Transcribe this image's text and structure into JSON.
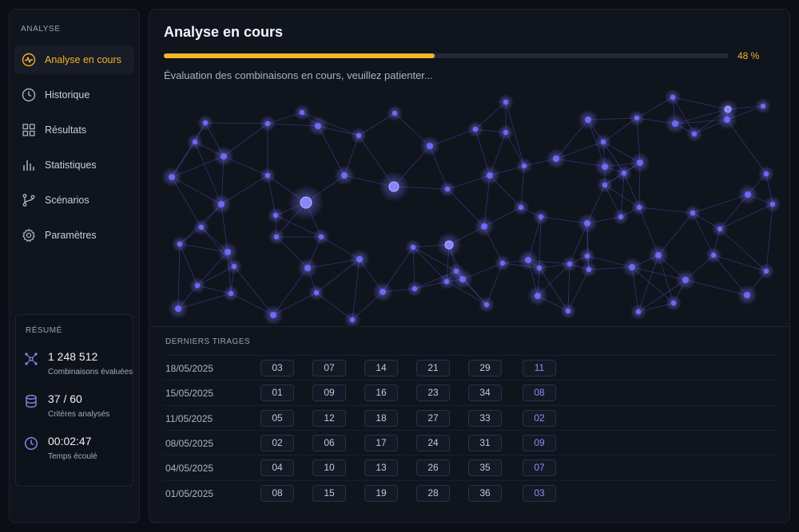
{
  "sidebar": {
    "heading": "ANALYSE",
    "items": [
      {
        "label": "Analyse en cours",
        "icon": "activity-icon",
        "active": true
      },
      {
        "label": "Historique",
        "icon": "clock-icon",
        "active": false
      },
      {
        "label": "Résultats",
        "icon": "grid-icon",
        "active": false
      },
      {
        "label": "Statistiques",
        "icon": "bar-chart-icon",
        "active": false
      },
      {
        "label": "Scénarios",
        "icon": "branch-icon",
        "active": false
      },
      {
        "label": "Paramètres",
        "icon": "gear-icon",
        "active": false
      }
    ],
    "summary": {
      "heading": "RÉSUMÉ",
      "stats": [
        {
          "value": "1 248 512",
          "label": "Combinaisons évaluées",
          "icon": "network-icon"
        },
        {
          "value": "37 / 60",
          "label": "Critères analysés",
          "icon": "database-icon"
        },
        {
          "value": "00:02:47",
          "label": "Temps écoulé",
          "icon": "clock-icon"
        }
      ]
    }
  },
  "main": {
    "title": "Analyse en cours",
    "progress": {
      "fraction": 0.48,
      "label": "48 %"
    },
    "status": "Évaluation des combinaisons en cours, veuillez patienter...",
    "draws": {
      "heading": "DERNIERS TIRAGES",
      "rows": [
        {
          "date": "18/05/2025",
          "numbers": [
            "03",
            "07",
            "14",
            "21",
            "29"
          ],
          "bonus": "11"
        },
        {
          "date": "15/05/2025",
          "numbers": [
            "01",
            "09",
            "16",
            "23",
            "34"
          ],
          "bonus": "08"
        },
        {
          "date": "11/05/2025",
          "numbers": [
            "05",
            "12",
            "18",
            "27",
            "33"
          ],
          "bonus": "02"
        },
        {
          "date": "08/05/2025",
          "numbers": [
            "02",
            "06",
            "17",
            "24",
            "31"
          ],
          "bonus": "09"
        },
        {
          "date": "04/05/2025",
          "numbers": [
            "04",
            "10",
            "13",
            "26",
            "35"
          ],
          "bonus": "07"
        },
        {
          "date": "01/05/2025",
          "numbers": [
            "08",
            "15",
            "19",
            "28",
            "36"
          ],
          "bonus": "03"
        }
      ]
    }
  },
  "colors": {
    "accent": "#f0b429",
    "node": "#6d6af5",
    "background": "#0b0e15",
    "panel": "#10141d"
  }
}
